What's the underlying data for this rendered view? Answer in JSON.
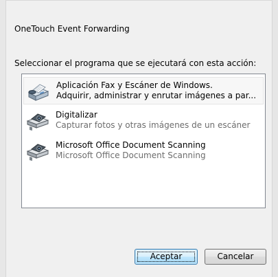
{
  "dialog": {
    "title": "OneTouch Event Forwarding",
    "instruction": "Seleccionar el programa que se ejecutará con esta acción:"
  },
  "programs": [
    {
      "title": "Aplicación Fax y Escáner de Windows.",
      "description": "Adquirir, administrar y enrutar imágenes a par...",
      "icon": "fax-scanner-icon",
      "selected": true
    },
    {
      "title": "Digitalizar",
      "description": "Capturar fotos y otras imágenes de un escáner",
      "icon": "camera-scanner-icon",
      "selected": false
    },
    {
      "title": "Microsoft Office Document Scanning",
      "description": "Microsoft Office Document Scanning",
      "icon": "camera-scanner-icon",
      "selected": false
    }
  ],
  "buttons": {
    "accept": "Aceptar",
    "cancel": "Cancelar"
  }
}
